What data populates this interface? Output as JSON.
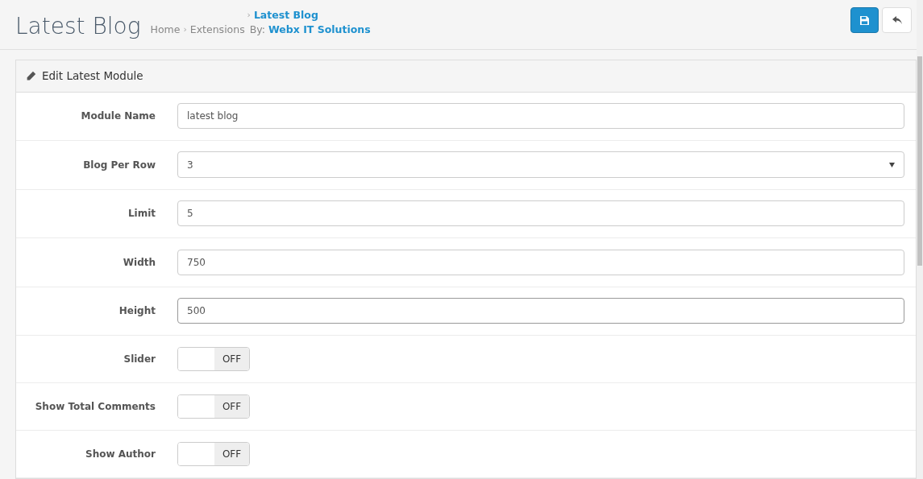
{
  "header": {
    "title": "Latest Blog",
    "separator": "›",
    "breadcrumbs": [
      {
        "label": "Home"
      },
      {
        "label": "Extensions"
      },
      {
        "label": "Latest Blog"
      }
    ],
    "by_line": "By: **Webx IT Solutions**",
    "buttons": [
      {
        "kind": "save"
      },
      {
        "kind": "back"
      }
    ]
  },
  "panel": {
    "title": "Edit Latest Module",
    "rows": [
      {
        "label": "Module Name",
        "kind": "text",
        "value": "latest blog",
        "focused": false
      },
      {
        "label": "Blog Per Row",
        "kind": "select",
        "value": "3",
        "focused": false
      },
      {
        "label": "Limit",
        "kind": "text",
        "value": "5",
        "focused": false
      },
      {
        "label": "Width",
        "kind": "text",
        "value": "750",
        "focused": false
      },
      {
        "label": "Height",
        "kind": "text",
        "value": "500",
        "focused": true
      },
      {
        "label": "Slider",
        "kind": "toggle",
        "state": "OFF",
        "on": false
      },
      {
        "label": "Show Total Comments",
        "kind": "toggle",
        "state": "OFF",
        "on": false
      },
      {
        "label": "Show Author",
        "kind": "toggle",
        "state": "OFF",
        "on": false
      }
    ]
  }
}
